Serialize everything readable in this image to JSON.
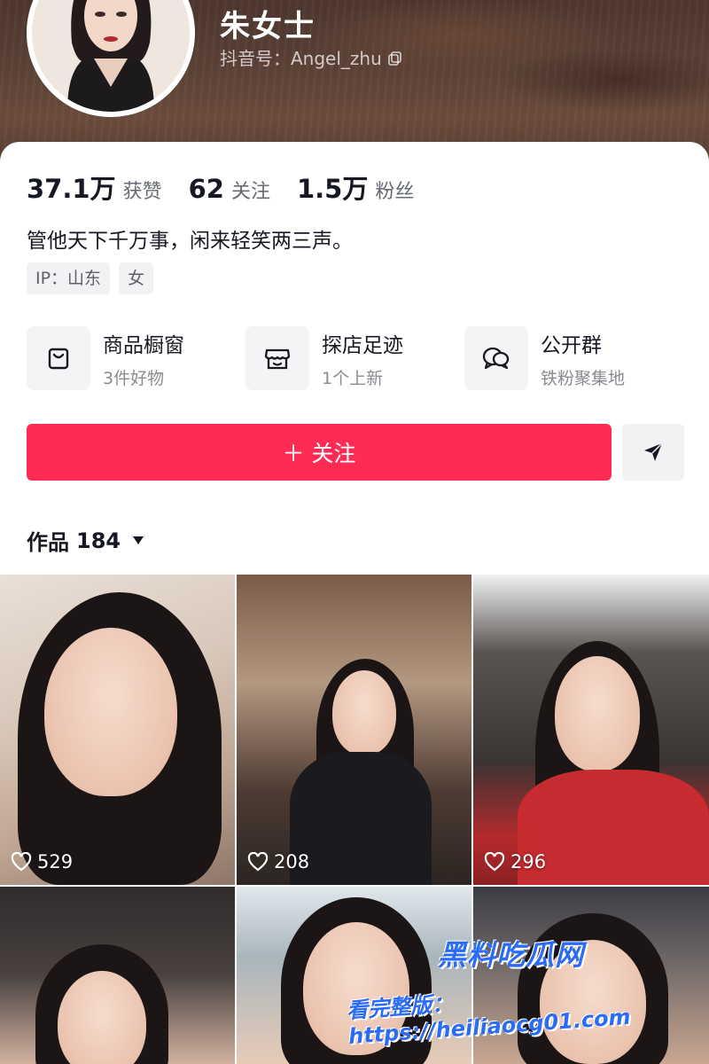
{
  "profile": {
    "nickname": "朱女士",
    "douyin_id": "抖音号：Angel_zhu",
    "bio": "管他天下千万事，闲来轻笑两三声。"
  },
  "stats": [
    {
      "num": "37.1万",
      "label": "获赞"
    },
    {
      "num": "62",
      "label": "关注"
    },
    {
      "num": "1.5万",
      "label": "粉丝"
    }
  ],
  "tags": [
    "IP：山东",
    "女"
  ],
  "services": [
    {
      "icon": "shopping-bag-icon",
      "title": "商品橱窗",
      "sub": "3件好物"
    },
    {
      "icon": "store-icon",
      "title": "探店足迹",
      "sub": "1个上新"
    },
    {
      "icon": "chat-bubbles-icon",
      "title": "公开群",
      "sub": "铁粉聚集地"
    }
  ],
  "follow_button": "＋ 关注",
  "works": {
    "label": "作品",
    "count": "184"
  },
  "grid": [
    {
      "likes": "529"
    },
    {
      "likes": "208"
    },
    {
      "likes": "296"
    },
    {
      "likes": ""
    },
    {
      "likes": ""
    },
    {
      "likes": ""
    }
  ],
  "watermark": {
    "brand": "黑料吃瓜网",
    "url": "看完整版：https://heiliaocg01.com"
  },
  "colors": {
    "accent": "#fe2c55",
    "watermark": "#2b6cf6"
  }
}
